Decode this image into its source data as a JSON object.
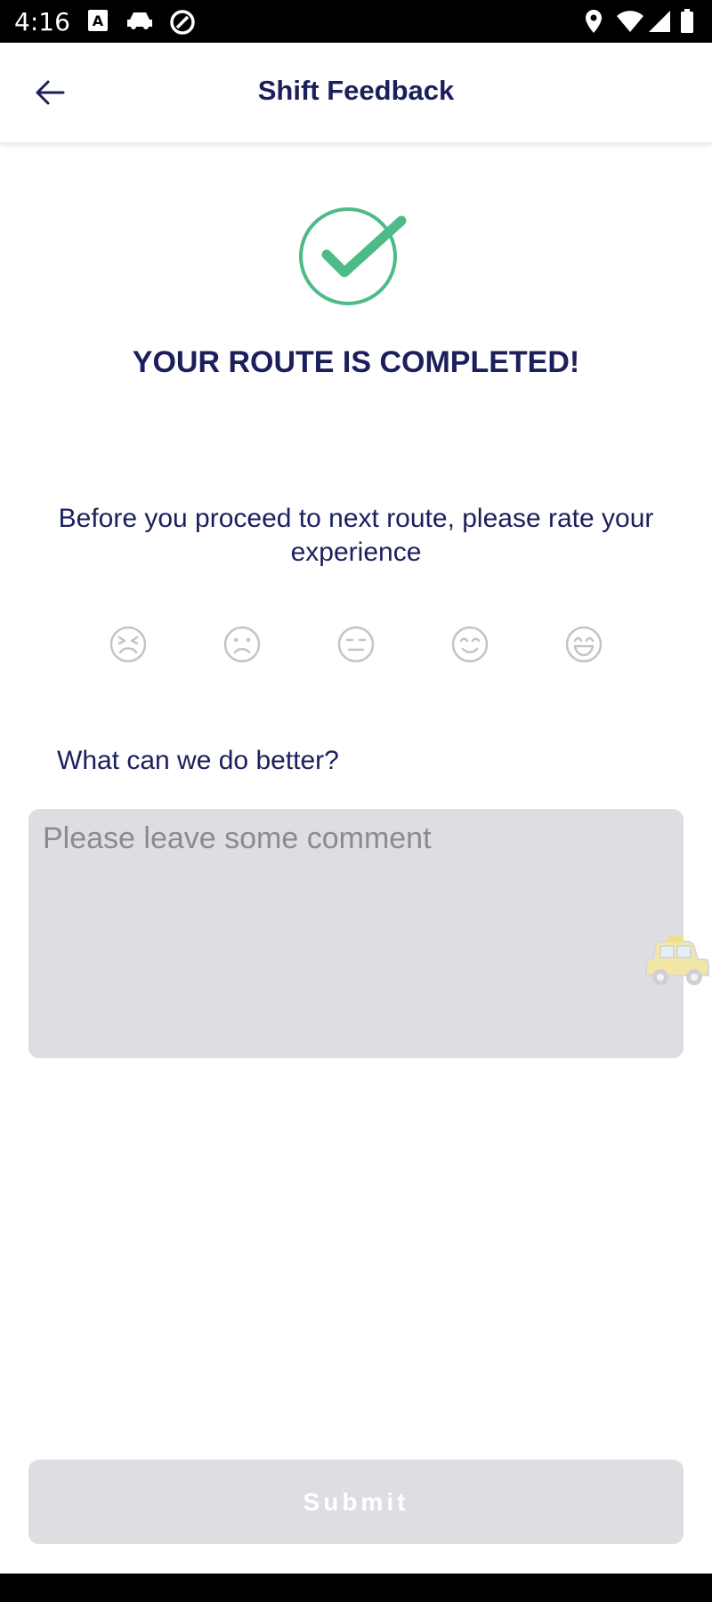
{
  "status_bar": {
    "time": "4:16",
    "icons": [
      "text-a-icon",
      "car-icon",
      "at-sign-icon",
      "location-icon",
      "wifi-icon",
      "signal-icon",
      "battery-icon"
    ]
  },
  "header": {
    "title": "Shift Feedback",
    "back_icon": "arrow-left-icon"
  },
  "main": {
    "success_icon": "check-circle-icon",
    "headline": "YOUR ROUTE IS COMPLETED!",
    "prompt": "Before you proceed to next route, please rate your experience",
    "ratings": [
      {
        "name": "very-dissatisfied",
        "icon": "face-very-sad-icon"
      },
      {
        "name": "dissatisfied",
        "icon": "face-sad-icon"
      },
      {
        "name": "neutral",
        "icon": "face-neutral-icon"
      },
      {
        "name": "satisfied",
        "icon": "face-smile-icon"
      },
      {
        "name": "very-satisfied",
        "icon": "face-very-happy-icon"
      }
    ],
    "feedback_label": "What can we do better?",
    "comment": {
      "value": "",
      "placeholder": "Please leave some comment"
    },
    "floating_icon": "taxi-icon"
  },
  "footer": {
    "submit_label": "Submit"
  },
  "colors": {
    "primary_text": "#1b1f5c",
    "success": "#4cbb87",
    "disabled_bg": "#dedee2",
    "icon_gray": "#c4c4c8"
  }
}
